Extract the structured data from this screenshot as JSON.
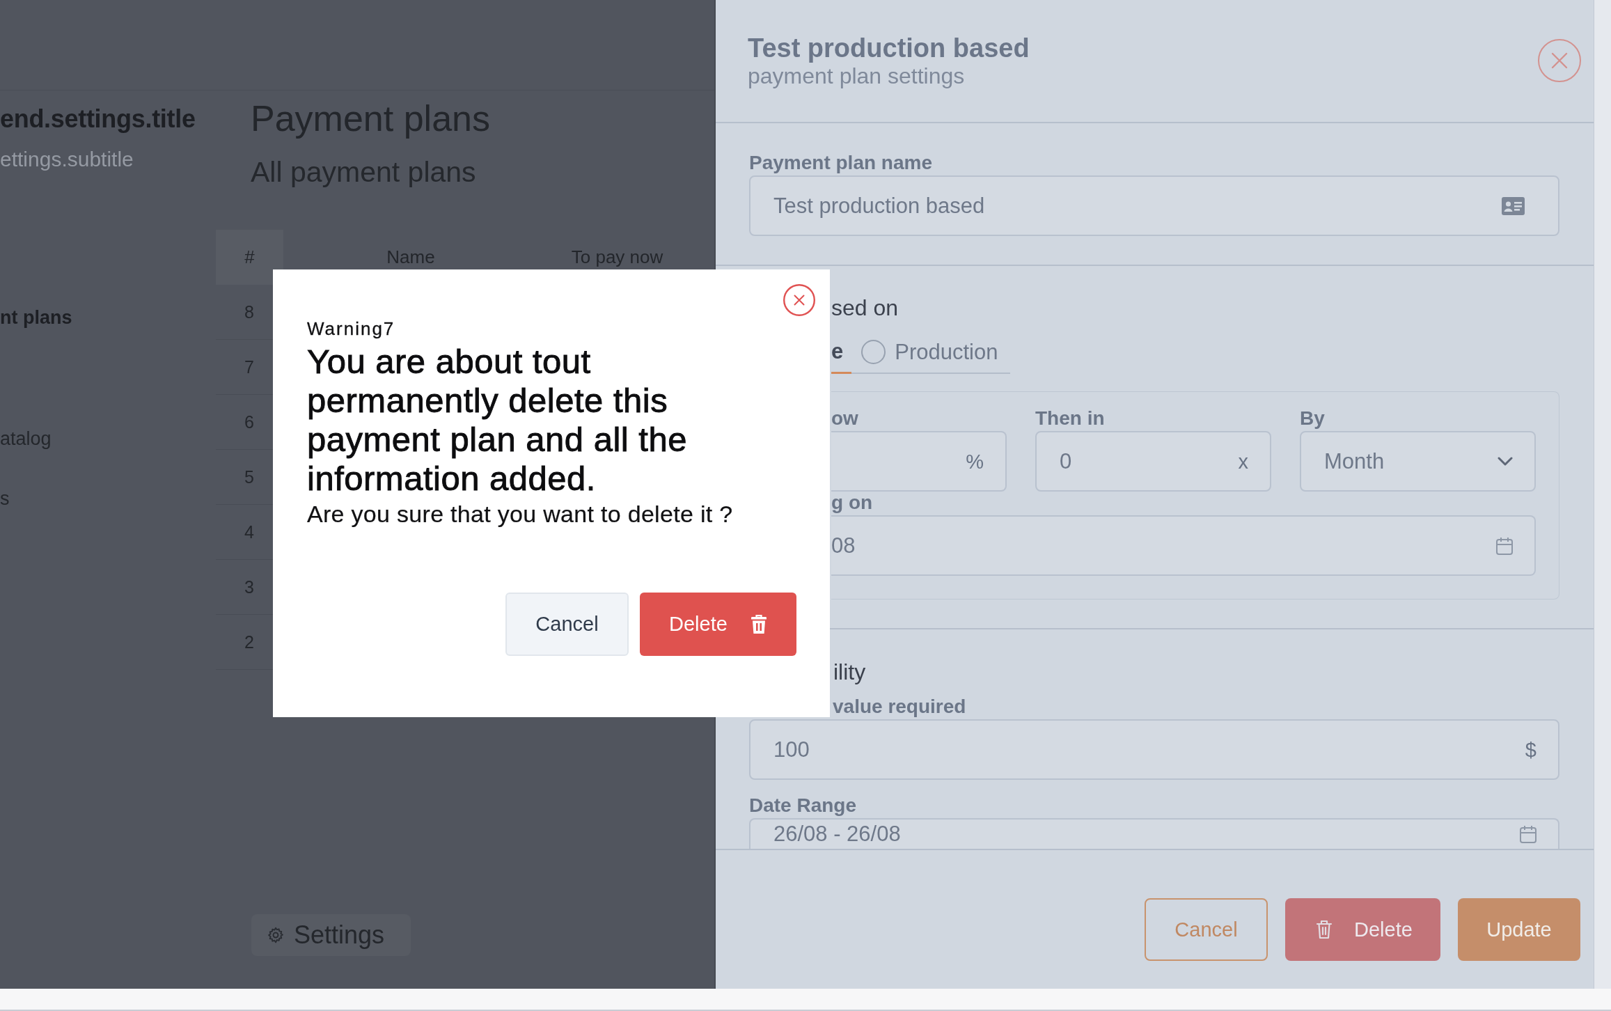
{
  "page": {
    "sidebar": {
      "title": "end.settings.title",
      "subtitle": "ettings.subtitle",
      "groups": [
        {
          "items": [
            {
              "label": "nt plans",
              "selected": true
            }
          ]
        },
        {
          "items": [
            {
              "label": "atalog",
              "selected": false
            },
            {
              "label": "s",
              "selected": false
            }
          ]
        }
      ]
    },
    "main": {
      "title": "Payment plans",
      "subtitle": "All payment plans",
      "table": {
        "columns": [
          "#",
          "Name",
          "To pay now"
        ],
        "rows": [
          {
            "number": "8"
          },
          {
            "number": "7"
          },
          {
            "number": "6"
          },
          {
            "number": "5"
          },
          {
            "number": "4"
          },
          {
            "number": "3"
          },
          {
            "number": "2"
          }
        ]
      },
      "settings_button": {
        "label": "Settings"
      }
    }
  },
  "drawer": {
    "title": "Test production based",
    "subtitle": "payment plan settings",
    "sections": [
      {
        "fields": [
          {
            "kind": "text",
            "label": "Payment plan name",
            "value": "Test production based"
          }
        ]
      },
      {
        "heading": "sed on",
        "options": [
          {
            "label": "e",
            "selected": true
          },
          {
            "label": "Production",
            "selected": false
          }
        ],
        "box": {
          "fields": [
            {
              "kind": "suffix",
              "label": "ow",
              "suffix": "%"
            },
            {
              "kind": "suffix",
              "label": "Then in",
              "value": "0",
              "suffix": "x"
            },
            {
              "kind": "select",
              "label": "By",
              "value": "Month"
            },
            {
              "kind": "date",
              "label": "g on",
              "value": "08"
            }
          ]
        }
      },
      {
        "heading": "ility",
        "fields": [
          {
            "kind": "suffix",
            "label": "value required",
            "value": "100",
            "suffix": "$"
          },
          {
            "kind": "date",
            "label": "Date Range",
            "value": "26/08 - 26/08"
          }
        ]
      }
    ],
    "buttons": [
      {
        "kind": "cancel",
        "label": "Cancel"
      },
      {
        "kind": "delete",
        "label": "Delete"
      },
      {
        "kind": "update",
        "label": "Update"
      }
    ]
  },
  "dialog": {
    "label": "Warning7",
    "message": "You are about tout permanently delete this payment plan and all the information added.",
    "question": "Are you sure that you want to delete it ?",
    "buttons": [
      {
        "kind": "cancel",
        "label": "Cancel"
      },
      {
        "kind": "delete",
        "label": "Delete"
      }
    ]
  }
}
